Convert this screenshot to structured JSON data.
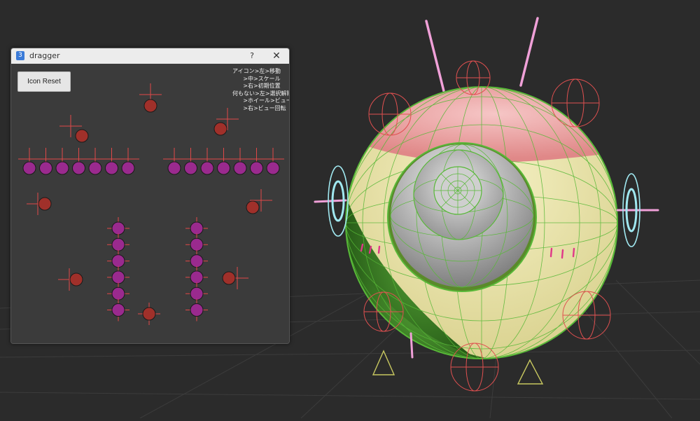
{
  "dialog": {
    "title": "dragger",
    "app_icon_glyph": "3",
    "help_button": "?",
    "close_button": "✕",
    "reset_button_label": "Icon Reset",
    "help_lines": [
      "アイコン>左>移動",
      "      >中>スケール",
      "      >右>初期位置",
      "何もない>左>選択解除",
      "      >ホイール>ビュー",
      "      >右>ビュー回転"
    ]
  },
  "colors": {
    "viewport_background": "#2b2b2b",
    "dialog_background": "#3b3b3b",
    "titlebar": "#ececec",
    "red_handle": "#a0302a",
    "purple_handle": "#9a2a8e",
    "crosshair": "#e04848",
    "wireframe_green": "#58b838",
    "pink_bar": "#f0a0d8",
    "cyan_arc": "#a0e8f0",
    "ground_triangle": "#c8c860"
  },
  "icons": {
    "app_icon": "maya-app-icon",
    "help": "question-mark-icon",
    "close": "close-x-icon"
  }
}
